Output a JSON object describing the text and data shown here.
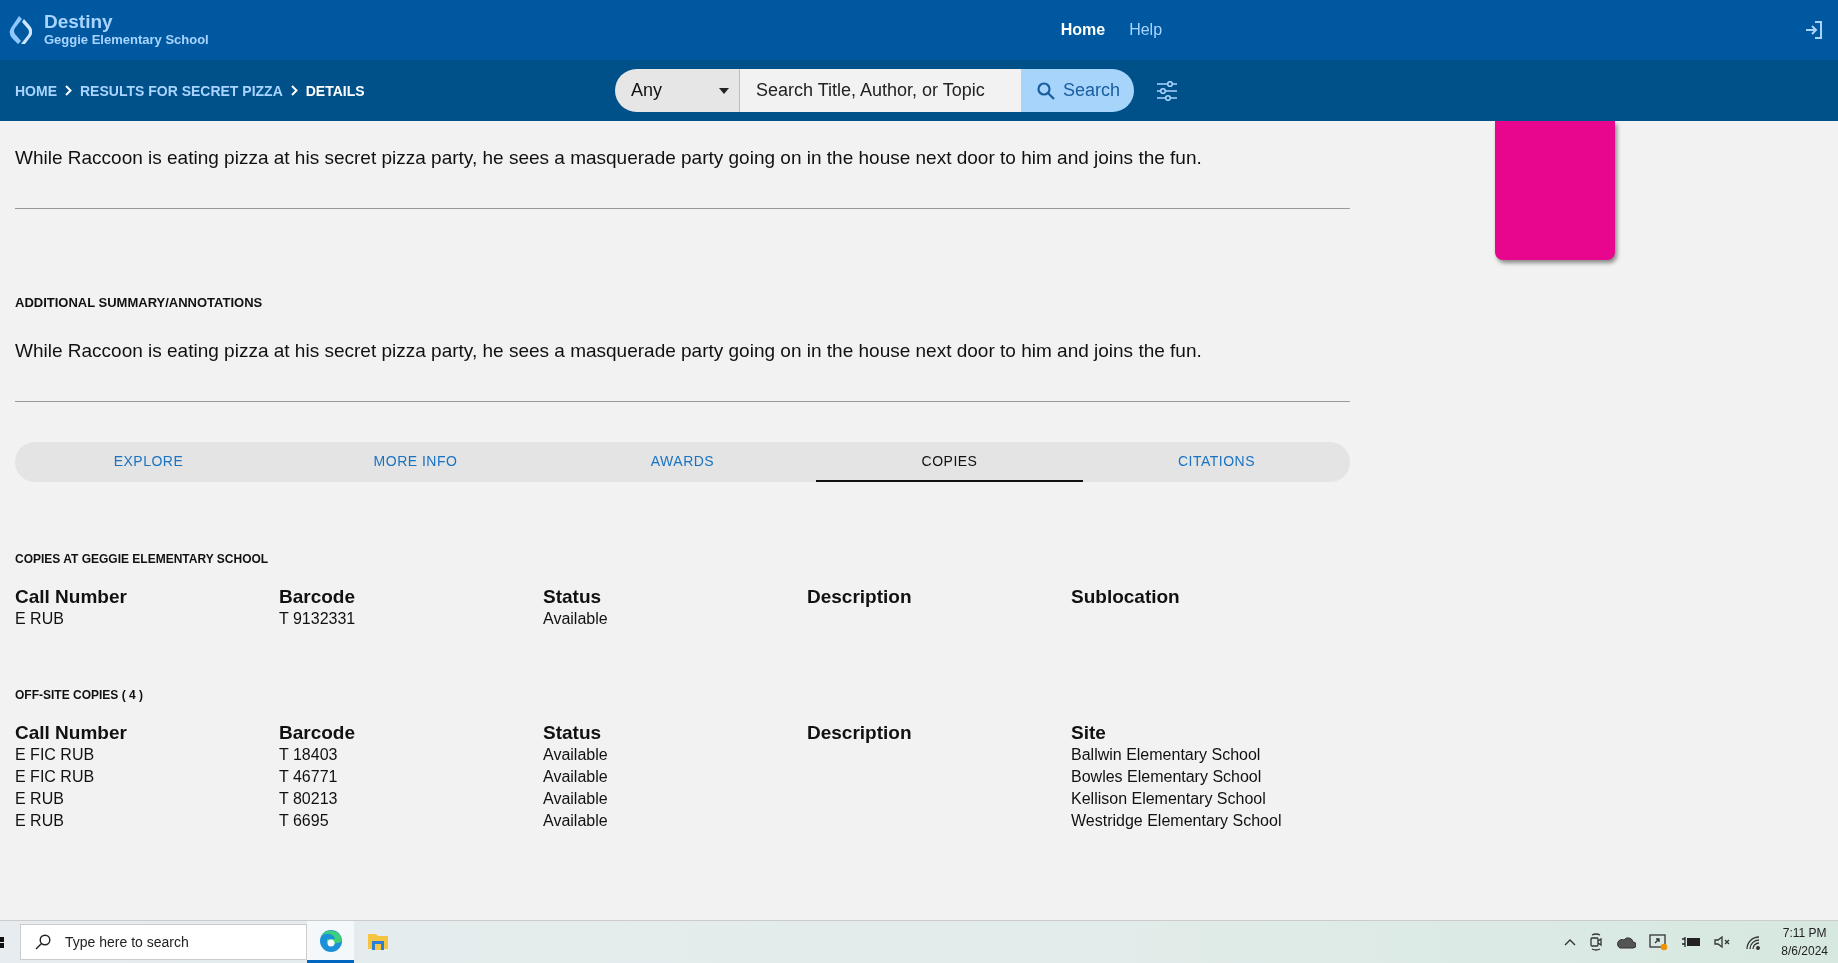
{
  "header": {
    "app_name": "Destiny",
    "school": "Geggie Elementary School",
    "nav": [
      {
        "label": "Home",
        "selected": true
      },
      {
        "label": "Help",
        "selected": false
      }
    ]
  },
  "breadcrumbs": [
    {
      "label": "HOME",
      "current": false
    },
    {
      "label": "RESULTS FOR SECRET PIZZA",
      "current": false
    },
    {
      "label": "DETAILS",
      "current": true
    }
  ],
  "search": {
    "scope": "Any",
    "placeholder": "Search Title, Author, or Topic",
    "button": "Search"
  },
  "summary": "While Raccoon is eating pizza at his secret pizza party, he sees a masquerade party going on in the house next door to him and joins the fun.",
  "additional": {
    "heading": "ADDITIONAL SUMMARY/ANNOTATIONS",
    "text": "While Raccoon is eating pizza at his secret pizza party, he sees a masquerade party going on in the house next door to him and joins the fun."
  },
  "tabs": [
    {
      "label": "EXPLORE",
      "selected": false
    },
    {
      "label": "MORE INFO",
      "selected": false
    },
    {
      "label": "AWARDS",
      "selected": false
    },
    {
      "label": "COPIES",
      "selected": true
    },
    {
      "label": "CITATIONS",
      "selected": false
    }
  ],
  "copies": {
    "heading": "COPIES AT GEGGIE ELEMENTARY SCHOOL",
    "columns": [
      "Call Number",
      "Barcode",
      "Status",
      "Description",
      "Sublocation"
    ],
    "rows": [
      {
        "call_number": "E RUB",
        "barcode": "T 9132331",
        "status": "Available"
      }
    ]
  },
  "offsite": {
    "heading": "OFF-SITE COPIES ( 4 )",
    "columns": [
      "Call Number",
      "Barcode",
      "Status",
      "Description",
      "Site"
    ],
    "rows": [
      {
        "call_number": "E FIC RUB",
        "barcode": "T 18403",
        "status": "Available",
        "site": "Ballwin Elementary School"
      },
      {
        "call_number": "E FIC RUB",
        "barcode": "T 46771",
        "status": "Available",
        "site": "Bowles Elementary School"
      },
      {
        "call_number": "E RUB",
        "barcode": "T 80213",
        "status": "Available",
        "site": "Kellison Elementary School"
      },
      {
        "call_number": "E RUB",
        "barcode": "T 6695",
        "status": "Available",
        "site": "Westridge Elementary School"
      }
    ]
  },
  "taskbar": {
    "search_placeholder": "Type here to search",
    "apps": [
      {
        "kind": "browser",
        "selected": true
      },
      {
        "kind": "folder",
        "selected": false
      }
    ],
    "time": "7:11 PM",
    "date": "8/6/2024"
  }
}
